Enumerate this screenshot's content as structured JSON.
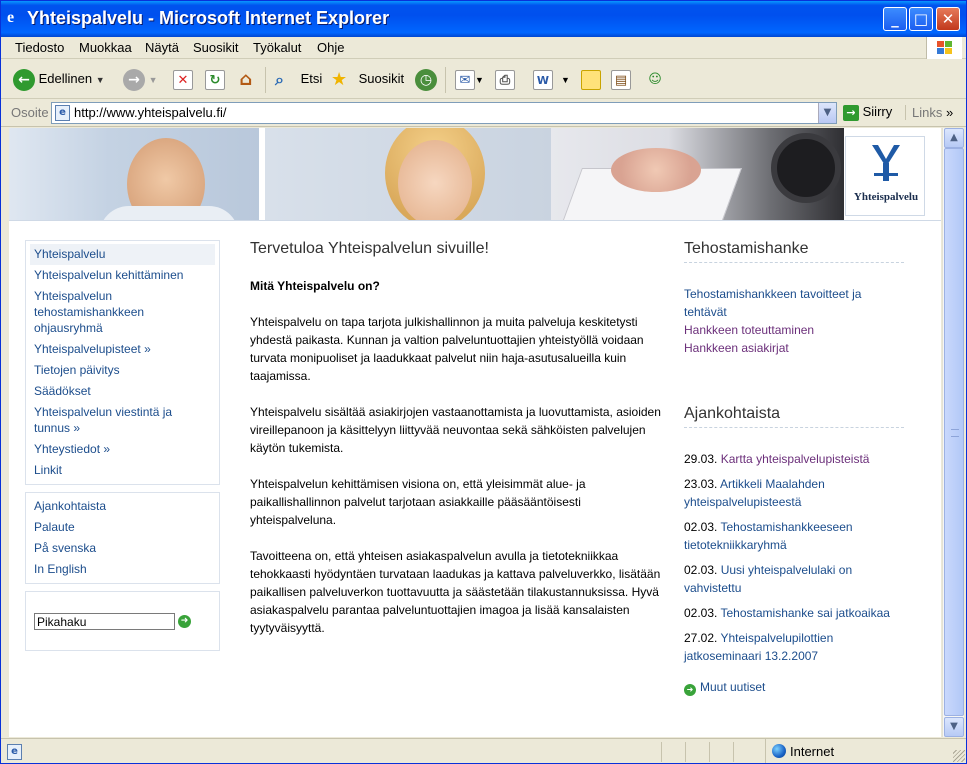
{
  "window": {
    "title": "Yhteispalvelu - Microsoft Internet Explorer"
  },
  "menu": [
    "Tiedosto",
    "Muokkaa",
    "Näytä",
    "Suosikit",
    "Työkalut",
    "Ohje"
  ],
  "toolbar": {
    "back": "Edellinen",
    "search": "Etsi",
    "favorites": "Suosikit"
  },
  "address": {
    "label": "Osoite",
    "url": "http://www.yhteispalvelu.fi/",
    "go": "Siirry",
    "links": "Links"
  },
  "status": {
    "zone": "Internet"
  },
  "logo": {
    "text": "Yhteispalvelu"
  },
  "nav1": [
    {
      "label": "Yhteispalvelu"
    },
    {
      "label": "Yhteispalvelun kehittäminen"
    },
    {
      "label": "Yhteispalvelun tehostamishankkeen ohjausryhmä"
    },
    {
      "label": "Yhteispalvelupisteet »"
    },
    {
      "label": "Tietojen päivitys"
    },
    {
      "label": "Säädökset"
    },
    {
      "label": "Yhteispalvelun viestintä ja tunnus »"
    },
    {
      "label": "Yhteystiedot »"
    },
    {
      "label": "Linkit"
    }
  ],
  "nav2": [
    {
      "label": "Ajankohtaista"
    },
    {
      "label": "Palaute"
    },
    {
      "label": "På svenska"
    },
    {
      "label": "In English"
    }
  ],
  "search": {
    "value": "Pikahaku"
  },
  "main": {
    "title": "Tervetuloa Yhteispalvelun sivuille!",
    "question": "Mitä Yhteispalvelu on?",
    "p1": "Yhteispalvelu on tapa tarjota julkishallinnon ja muita palveluja keskitetysti yhdestä paikasta. Kunnan ja valtion palveluntuottajien yhteistyöllä voidaan turvata monipuoliset ja laadukkaat palvelut niin haja-asutusalueilla kuin taajamissa.",
    "p2": "Yhteispalvelu sisältää asiakirjojen vastaanottamista ja luovuttamista, asioiden vireillepanoon ja käsittelyyn liittyvää neuvontaa sekä sähköisten palvelujen käytön tukemista.",
    "p3": "Yhteispalvelun kehittämisen visiona on, että yleisimmät alue- ja paikallishallinnon palvelut tarjotaan asiakkaille pääsääntöisesti yhteispalveluna.",
    "p4": "Tavoitteena on, että yhteisen asiakaspalvelun avulla ja tietotekniikkaa tehokkaasti hyödyntäen turvataan laadukas ja kattava palveluverkko, lisätään paikallisen palveluverkon tuottavuutta ja säästetään tilakustannuksissa. Hyvä asiakaspalvelu parantaa palveluntuottajien imagoa ja lisää kansalaisten tyytyväisyyttä."
  },
  "right": {
    "h1": "Tehostamishanke",
    "links": [
      {
        "label": "Tehostamishankkeen tavoitteet ja tehtävät"
      },
      {
        "label": "Hankkeen toteuttaminen"
      },
      {
        "label": "Hankkeen asiakirjat"
      }
    ],
    "h2": "Ajankohtaista",
    "news": [
      {
        "date": "29.03.",
        "title": "Kartta yhteispalvelupisteistä"
      },
      {
        "date": "23.03.",
        "title": "Artikkeli Maalahden yhteispalvelupisteestä"
      },
      {
        "date": "02.03.",
        "title": "Tehostamishankkeeseen tietotekniikkaryhmä"
      },
      {
        "date": "02.03.",
        "title": "Uusi yhteispalvelulaki on vahvistettu"
      },
      {
        "date": "02.03.",
        "title": "Tehostamishanke sai jatkoaikaa"
      },
      {
        "date": "27.02.",
        "title": "Yhteispalvelupilottien jatkoseminaari 13.2.2007"
      }
    ],
    "more": "Muut uutiset"
  }
}
